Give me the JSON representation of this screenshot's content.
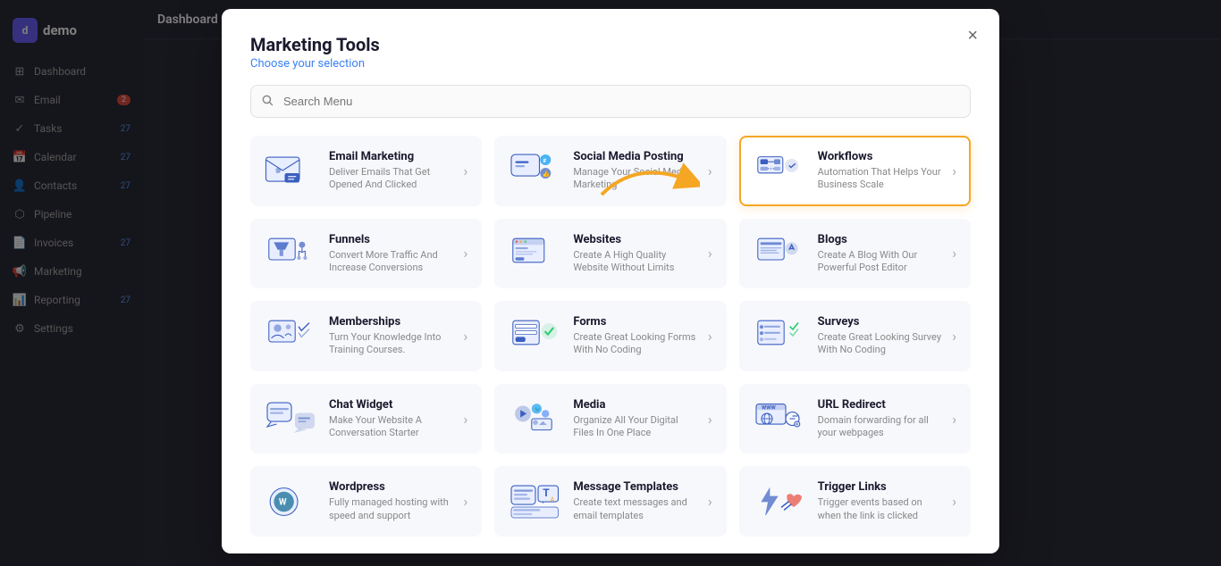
{
  "app": {
    "name": "demo",
    "topbar_title": "Dashboard"
  },
  "sidebar": {
    "items": [
      {
        "label": "Dashboard",
        "icon": "⊞",
        "badge": null
      },
      {
        "label": "Email",
        "icon": "✉",
        "badge": "2"
      },
      {
        "label": "Tasks",
        "icon": "✓",
        "date": "27"
      },
      {
        "label": "Calendar",
        "icon": "📅",
        "date": "27"
      },
      {
        "label": "Contacts",
        "icon": "👤",
        "date": "27"
      },
      {
        "label": "Pipeline",
        "icon": "⬡",
        "date": ""
      },
      {
        "label": "Invoices",
        "icon": "📄",
        "date": "27"
      },
      {
        "label": "Marketing",
        "icon": "📢",
        "date": ""
      },
      {
        "label": "Reporting",
        "icon": "📊",
        "date": "27"
      },
      {
        "label": "Settings",
        "icon": "⚙",
        "date": ""
      }
    ]
  },
  "modal": {
    "title": "Marketing Tools",
    "subtitle": "Choose your selection",
    "close_label": "×",
    "search_placeholder": "Search Menu"
  },
  "tools": [
    {
      "id": "email-marketing",
      "name": "Email Marketing",
      "description": "Deliver Emails That Get Opened And Clicked",
      "highlighted": false
    },
    {
      "id": "social-media",
      "name": "Social Media Posting",
      "description": "Manage Your Social Media Marketing",
      "highlighted": false
    },
    {
      "id": "workflows",
      "name": "Workflows",
      "description": "Automation That Helps Your Business Scale",
      "highlighted": true
    },
    {
      "id": "funnels",
      "name": "Funnels",
      "description": "Convert More Traffic And Increase Conversions",
      "highlighted": false
    },
    {
      "id": "websites",
      "name": "Websites",
      "description": "Create A High Quality Website Without Limits",
      "highlighted": false
    },
    {
      "id": "blogs",
      "name": "Blogs",
      "description": "Create A Blog With Our Powerful Post Editor",
      "highlighted": false
    },
    {
      "id": "memberships",
      "name": "Memberships",
      "description": "Turn Your Knowledge Into Training Courses.",
      "highlighted": false
    },
    {
      "id": "forms",
      "name": "Forms",
      "description": "Create Great Looking Forms With No Coding",
      "highlighted": false
    },
    {
      "id": "surveys",
      "name": "Surveys",
      "description": "Create Great Looking Survey With No Coding",
      "highlighted": false
    },
    {
      "id": "chat-widget",
      "name": "Chat Widget",
      "description": "Make Your Website A Conversation Starter",
      "highlighted": false
    },
    {
      "id": "media",
      "name": "Media",
      "description": "Organize All Your Digital Files In One Place",
      "highlighted": false
    },
    {
      "id": "url-redirect",
      "name": "URL Redirect",
      "description": "Domain forwarding for all your webpages",
      "highlighted": false
    },
    {
      "id": "wordpress",
      "name": "Wordpress",
      "description": "Fully managed hosting with speed and support",
      "highlighted": false
    },
    {
      "id": "message-templates",
      "name": "Message Templates",
      "description": "Create text messages and email templates",
      "highlighted": false
    },
    {
      "id": "trigger-links",
      "name": "Trigger Links",
      "description": "Trigger events based on when the link is clicked",
      "highlighted": false
    }
  ],
  "arrow": "→"
}
